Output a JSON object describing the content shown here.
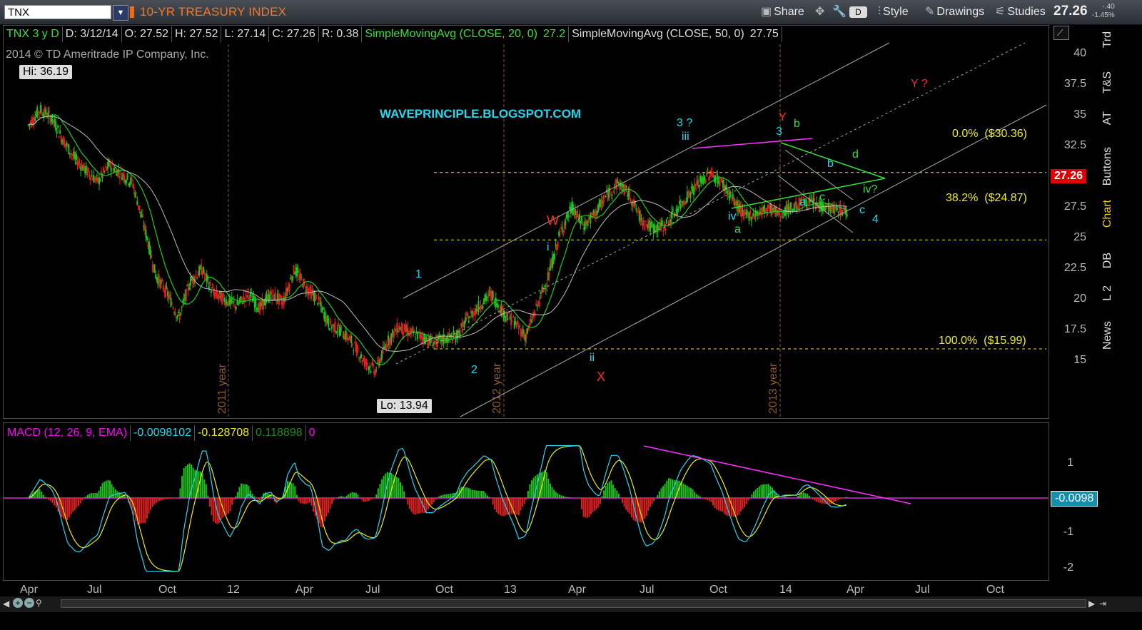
{
  "toolbar": {
    "symbol": "TNX",
    "title": "10-YR TREASURY INDEX",
    "share_label": "Share",
    "d_label": "D",
    "style_label": "Style",
    "drawings_label": "Drawings",
    "studies_label": "Studies",
    "last_price": "27.26",
    "net_change": "-.40",
    "pct_change": "-1.45%"
  },
  "infobar": {
    "symbol_period": "TNX 3 y D",
    "date": "D: 3/12/14",
    "open": "O: 27.52",
    "high": "H: 27.52",
    "low": "L: 27.14",
    "close": "C: 27.26",
    "range": "R: 0.38",
    "sma20_label": "SimpleMovingAvg (CLOSE, 20, 0)",
    "sma20_value": "27.2",
    "sma50_label": "SimpleMovingAvg (CLOSE, 50, 0)",
    "sma50_value": "27.75"
  },
  "copyright": "2014 © TD Ameritrade IP Company, Inc.",
  "hi_label": "Hi: 36.19",
  "lo_label": "Lo: 13.94",
  "price_badge": "27.26",
  "macd": {
    "label": "MACD (12, 26, 9, EMA)",
    "value": "-0.0098102",
    "avg": "-0.128708",
    "diff": "0.118898",
    "zero": "0",
    "badge": "-0.0098"
  },
  "side_tabs": [
    "Trd",
    "T&S",
    "AT",
    "Buttons",
    "Chart",
    "DB",
    "L 2",
    "News"
  ],
  "annotations": {
    "site": "WAVEPRINCIPLE.BLOGSPOT.COM",
    "fib0": "0.0%  ($30.36)",
    "fib382": "38.2%  ($24.87)",
    "fib100": "100.0%  ($15.99)",
    "year2011": "2011 year",
    "year2012": "2012 year",
    "year2013": "2013 year",
    "w1": "1",
    "w2": "2",
    "w3q": "3 ?",
    "wiii": "iii",
    "wi": "i",
    "wii": "ii",
    "wiv": "iv",
    "wa1": "a",
    "w3": "3",
    "wY": "Y",
    "wb1": "b",
    "wd": "d",
    "wb2": "b",
    "wa2": "a",
    "wc1": "c",
    "wivq": "iv?",
    "wc2": "c",
    "w4": "4",
    "wW": "W",
    "wX": "X",
    "wYq": "Y ?"
  },
  "colors": {
    "up": "#19c419",
    "down": "#e02020",
    "sma20": "#1fcc1f",
    "sma50": "#bdbdbd",
    "cyan": "#20d8f0",
    "red": "#ff2a2a",
    "green": "#35e035",
    "yellow": "#f0f000",
    "magenta": "#ff30ff"
  },
  "chart_data": [
    {
      "type": "candlestick",
      "title": "10-YR TREASURY INDEX",
      "y_ticks": [
        "40",
        "37.5",
        "35",
        "32.5",
        "30",
        "27.5",
        "25",
        "22.5",
        "20",
        "17.5",
        "15"
      ],
      "x_ticks": [
        "Apr",
        "Jul",
        "Oct",
        "12",
        "Apr",
        "Jul",
        "Oct",
        "13",
        "Apr",
        "Jul",
        "Oct",
        "14",
        "Apr",
        "Jul",
        "Oct"
      ],
      "ylim": [
        12.5,
        41.3
      ],
      "close_path": {
        "x": [
          0,
          0.5,
          1,
          1.5,
          2,
          2.5,
          3,
          3.5,
          4,
          4.5,
          5,
          5.5,
          6,
          6.5,
          7,
          7.5,
          8,
          8.5,
          9,
          9.5,
          10,
          10.5,
          11,
          11.5,
          12,
          12.5,
          13,
          13.5,
          14,
          14.5,
          15,
          15.5,
          16,
          16.5,
          17,
          17.5,
          18,
          18.5,
          19,
          19.5,
          20,
          20.5,
          21,
          21.5,
          22,
          22.5,
          23,
          23.5,
          24,
          24.5,
          25,
          25.5,
          26,
          26.5,
          27,
          27.5,
          28,
          28.5,
          29,
          29.5,
          30,
          30.5,
          31,
          31.5,
          32,
          32.5,
          33,
          33.5,
          34,
          34.5,
          35,
          35.5,
          36,
          36.2
        ],
        "y": [
          34.2,
          35.5,
          34.8,
          33.0,
          31.5,
          30.5,
          29.6,
          31.0,
          30.3,
          29.5,
          26.0,
          22.0,
          20.5,
          18.5,
          21.5,
          22.5,
          20.5,
          20.0,
          19.5,
          20.5,
          19.3,
          20.5,
          19.8,
          22.5,
          21.0,
          20.0,
          18.0,
          17.5,
          16.5,
          15.0,
          14.2,
          16.5,
          17.8,
          17.3,
          17.0,
          16.5,
          16.8,
          17.0,
          18.5,
          19.5,
          20.5,
          19.0,
          18.2,
          17.0,
          19.5,
          22.0,
          25.5,
          27.5,
          26.0,
          27.0,
          28.5,
          29.5,
          28.5,
          26.5,
          25.8,
          26.0,
          27.2,
          28.5,
          29.5,
          30.3,
          29.5,
          28.0,
          26.8,
          27.0,
          27.5,
          27.0,
          27.5,
          28.0,
          27.8,
          27.5,
          27.26,
          27.26,
          27.26,
          27.26
        ]
      },
      "fib_levels": [
        {
          "label": "0.0%",
          "value": 30.36
        },
        {
          "label": "38.2%",
          "value": 24.87
        },
        {
          "label": "100.0%",
          "value": 15.99
        }
      ],
      "hi": 36.19,
      "lo": 13.94,
      "last": 27.26,
      "series": [
        {
          "name": "SimpleMovingAvg (CLOSE, 20, 0)",
          "last": 27.2
        },
        {
          "name": "SimpleMovingAvg (CLOSE, 50, 0)",
          "last": 27.75
        }
      ]
    },
    {
      "type": "line",
      "title": "MACD (12, 26, 9, EMA)",
      "y_ticks": [
        "1",
        "-1",
        "-2"
      ],
      "ylim": [
        -2.2,
        1.6
      ],
      "last": -0.0098
    }
  ]
}
